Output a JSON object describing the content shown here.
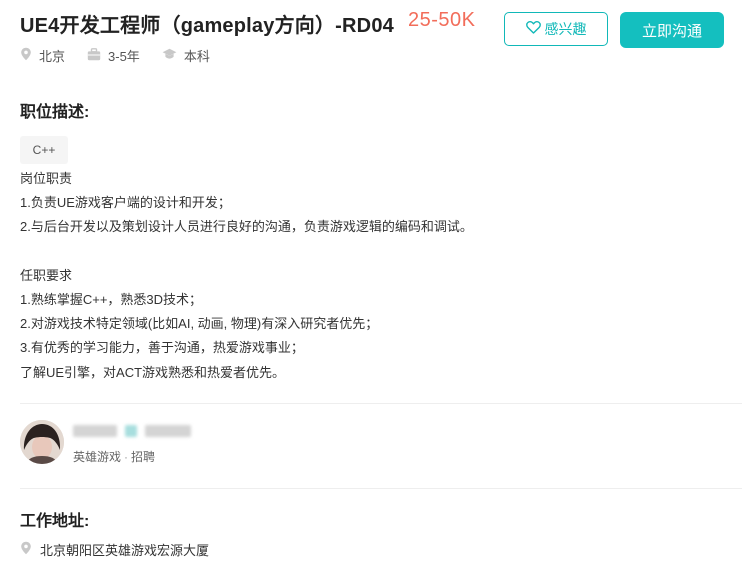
{
  "job": {
    "title": "UE4开发工程师（gameplay方向）-RD04",
    "salary": "25-50K",
    "meta": {
      "city": "北京",
      "experience": "3-5年",
      "education": "本科"
    }
  },
  "actions": {
    "interest_label": "感兴趣",
    "chat_label": "立即沟通"
  },
  "description": {
    "section_title": "职位描述:",
    "tags": [
      "C++"
    ],
    "lines": [
      "岗位职责",
      "1.负责UE游戏客户端的设计和开发；",
      "2.与后台开发以及策划设计人员进行良好的沟通，负责游戏逻辑的编码和调试。",
      "",
      "任职要求",
      "1.熟练掌握C++，熟悉3D技术；",
      "2.对游戏技术特定领域(比如AI, 动画, 物理)有深入研究者优先；",
      "3.有优秀的学习能力，善于沟通，热爱游戏事业；",
      "了解UE引擎，对ACT游戏熟悉和热爱者优先。"
    ]
  },
  "recruiter": {
    "company": "英雄游戏",
    "role": "招聘",
    "separator": "·"
  },
  "work_address": {
    "section_title": "工作地址:",
    "address": "北京朝阳区英雄游戏宏源大厦"
  },
  "colors": {
    "accent": "#14bfbf",
    "salary": "#f26d5a"
  },
  "icons": {
    "location": "location-pin-icon",
    "experience": "briefcase-icon",
    "education": "graduation-cap-icon",
    "interest": "heart-outline-icon"
  }
}
